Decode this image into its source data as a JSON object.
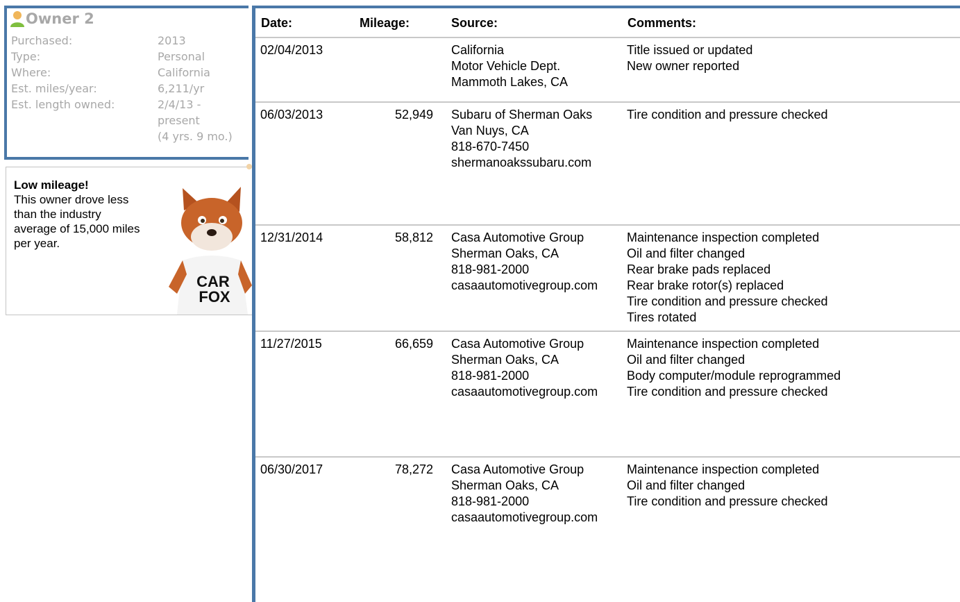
{
  "owner": {
    "title": "Owner 2",
    "details": [
      {
        "label": "Purchased:",
        "value": "2013"
      },
      {
        "label": "Type:",
        "value": "Personal"
      },
      {
        "label": "Where:",
        "value": "California"
      },
      {
        "label": "Est. miles/year:",
        "value": "6,211/yr"
      },
      {
        "label": "Est. length owned:",
        "value": "2/4/13 -",
        "value2": "present",
        "value3": "(4 yrs. 9 mo.)"
      }
    ]
  },
  "callout": {
    "title": "Low mileage!",
    "body": "This owner drove less than the industry average of 15,000 miles per year.",
    "mascot_text_1": "CAR",
    "mascot_text_2": "FOX"
  },
  "table": {
    "headers": {
      "date": "Date:",
      "mileage": "Mileage:",
      "source": "Source:",
      "comments": "Comments:"
    },
    "rows": [
      {
        "date": "02/04/2013",
        "mileage": "",
        "source": [
          "California",
          "Motor Vehicle Dept.",
          "Mammoth Lakes, CA"
        ],
        "comments": [
          "Title issued or updated",
          "New owner reported"
        ]
      },
      {
        "date": "06/03/2013",
        "mileage": "52,949",
        "source": [
          "Subaru of Sherman Oaks",
          "Van Nuys, CA",
          "818-670-7450",
          "shermanoakssubaru.com"
        ],
        "comments": [
          "Tire condition and pressure checked"
        ]
      },
      {
        "date": "12/31/2014",
        "mileage": "58,812",
        "source": [
          "Casa Automotive Group",
          "Sherman Oaks, CA",
          "818-981-2000",
          "casaautomotivegroup.com"
        ],
        "comments": [
          "Maintenance inspection completed",
          "Oil and filter changed",
          "Rear brake pads replaced",
          "Rear brake rotor(s) replaced",
          "Tire condition and pressure checked",
          "Tires rotated"
        ]
      },
      {
        "date": "11/27/2015",
        "mileage": "66,659",
        "source": [
          "Casa Automotive Group",
          "Sherman Oaks, CA",
          "818-981-2000",
          "casaautomotivegroup.com"
        ],
        "comments": [
          "Maintenance inspection completed",
          "Oil and filter changed",
          "Body computer/module reprogrammed",
          "Tire condition and pressure checked"
        ]
      },
      {
        "date": "06/30/2017",
        "mileage": "78,272",
        "source": [
          "Casa Automotive Group",
          "Sherman Oaks, CA",
          "818-981-2000",
          "casaautomotivegroup.com"
        ],
        "comments": [
          "Maintenance inspection completed",
          "Oil and filter changed",
          "Tire condition and pressure checked"
        ]
      }
    ]
  }
}
